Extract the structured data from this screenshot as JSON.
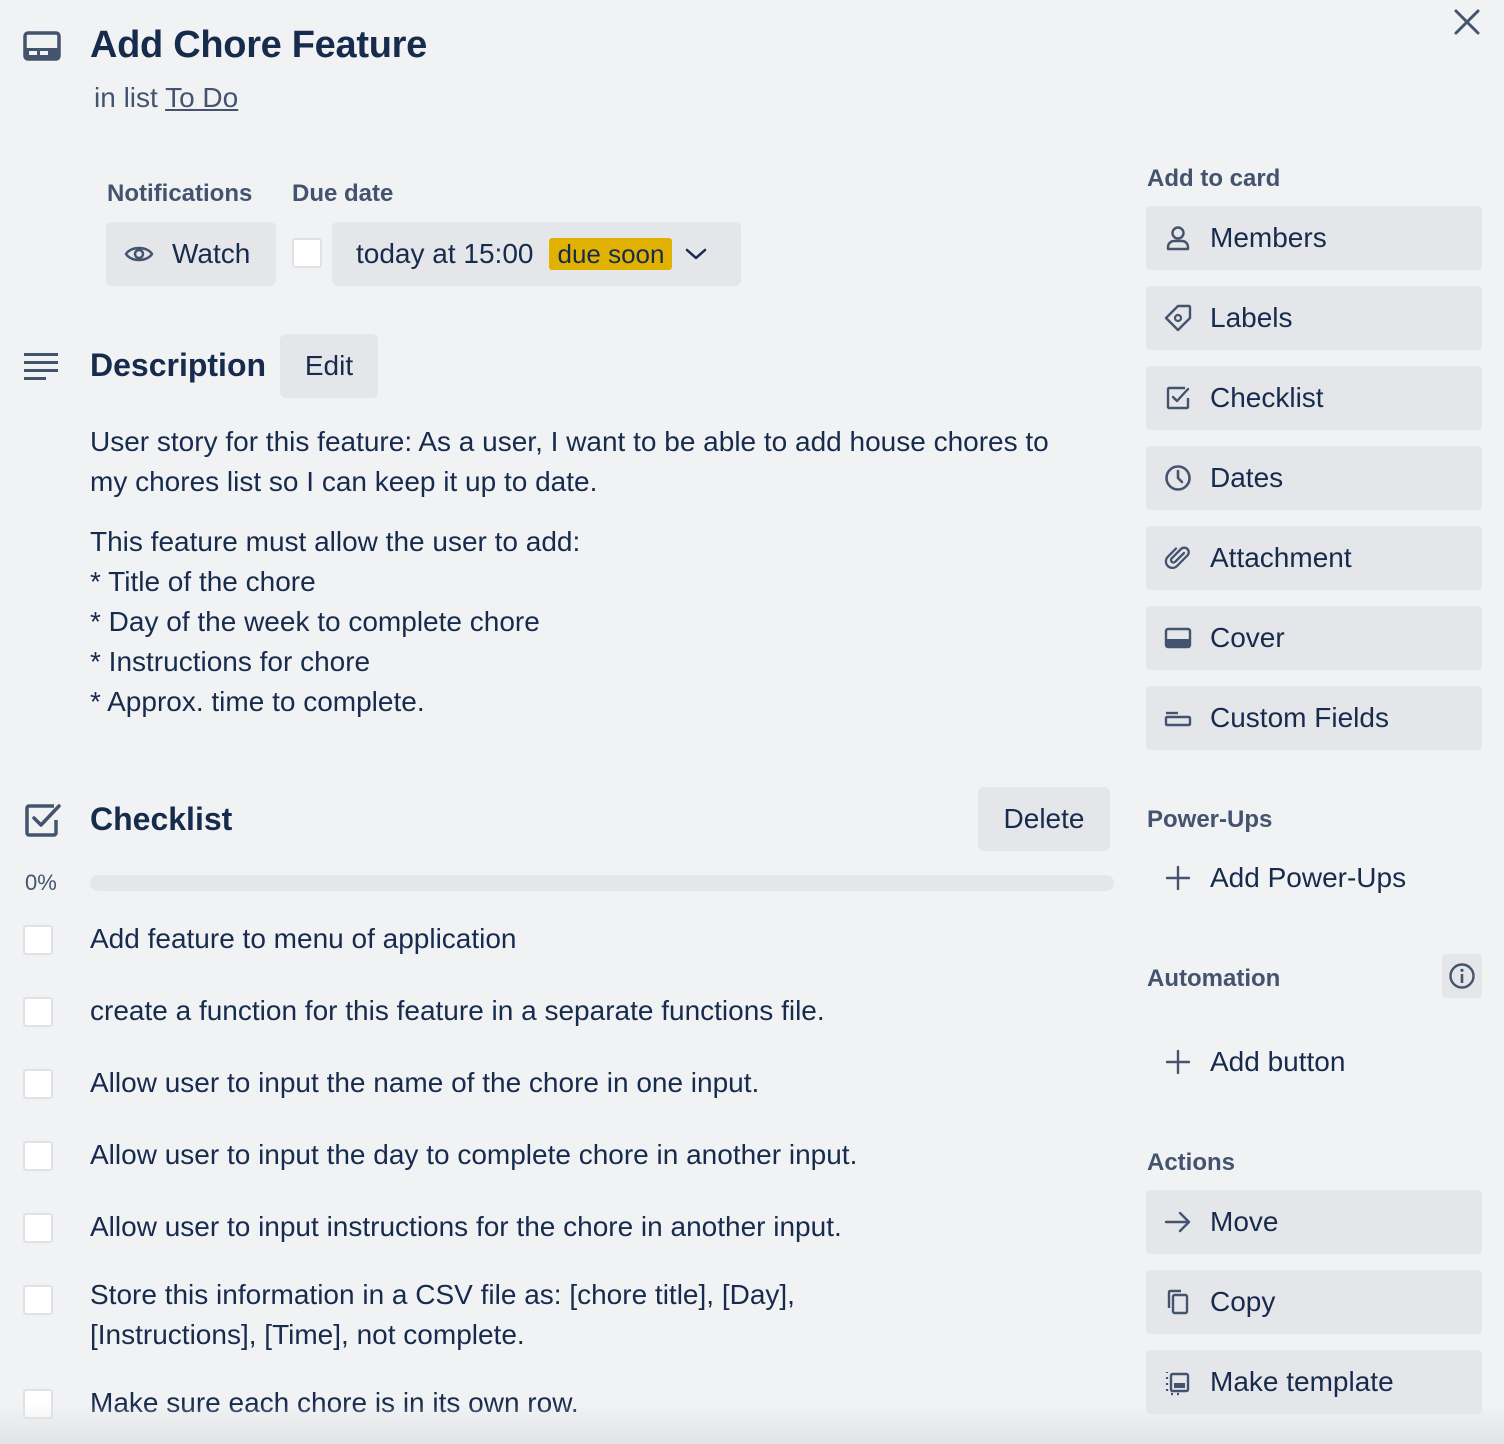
{
  "card": {
    "title": "Add Chore Feature",
    "list_prefix": "in list",
    "list_name": "To Do"
  },
  "meta": {
    "notifications_label": "Notifications",
    "watch_label": "Watch",
    "due_date_label": "Due date",
    "due_date_value": "today at 15:00",
    "due_badge": "due soon",
    "due_badge_color": "#e2b203"
  },
  "description": {
    "heading": "Description",
    "edit_label": "Edit",
    "paragraph1_line1": "User story for this feature: As a user, I want to be able to add house chores to",
    "paragraph1_line2": "my chores list so I can keep it up to date.",
    "paragraph2_lines": [
      "This feature must allow the user to add:",
      "* Title of the chore",
      "* Day of the week to complete chore",
      "* Instructions for chore",
      "* Approx. time to complete."
    ]
  },
  "checklist": {
    "heading": "Checklist",
    "delete_label": "Delete",
    "progress_label": "0%",
    "progress_fraction": 0,
    "items": [
      {
        "text": "Add feature to menu of application",
        "checked": false
      },
      {
        "text": "create a function for this feature in a separate functions file.",
        "checked": false
      },
      {
        "text": "Allow user to input the name of the chore in one input.",
        "checked": false
      },
      {
        "text": "Allow user to input the day to complete chore in another input.",
        "checked": false
      },
      {
        "text": "Allow user to input instructions for the chore in another input.",
        "checked": false
      },
      {
        "text_line1": "Store this information in a CSV file as: [chore title], [Day],",
        "text_line2": "[Instructions], [Time], not complete.",
        "checked": false
      },
      {
        "text": "Make sure each chore is in its own row.",
        "checked": false
      }
    ]
  },
  "sidebar": {
    "add_to_card_heading": "Add to card",
    "add_to_card": [
      {
        "label": "Members",
        "icon": "person-icon"
      },
      {
        "label": "Labels",
        "icon": "tag-icon"
      },
      {
        "label": "Checklist",
        "icon": "checklist-icon"
      },
      {
        "label": "Dates",
        "icon": "clock-icon"
      },
      {
        "label": "Attachment",
        "icon": "paperclip-icon"
      },
      {
        "label": "Cover",
        "icon": "cover-icon"
      },
      {
        "label": "Custom Fields",
        "icon": "custom-fields-icon"
      }
    ],
    "power_ups_heading": "Power-Ups",
    "add_power_ups_label": "Add Power-Ups",
    "automation_heading": "Automation",
    "add_button_label": "Add button",
    "actions_heading": "Actions",
    "actions": [
      {
        "label": "Move",
        "icon": "arrow-right-icon"
      },
      {
        "label": "Copy",
        "icon": "copy-icon"
      },
      {
        "label": "Make template",
        "icon": "template-icon"
      }
    ]
  }
}
